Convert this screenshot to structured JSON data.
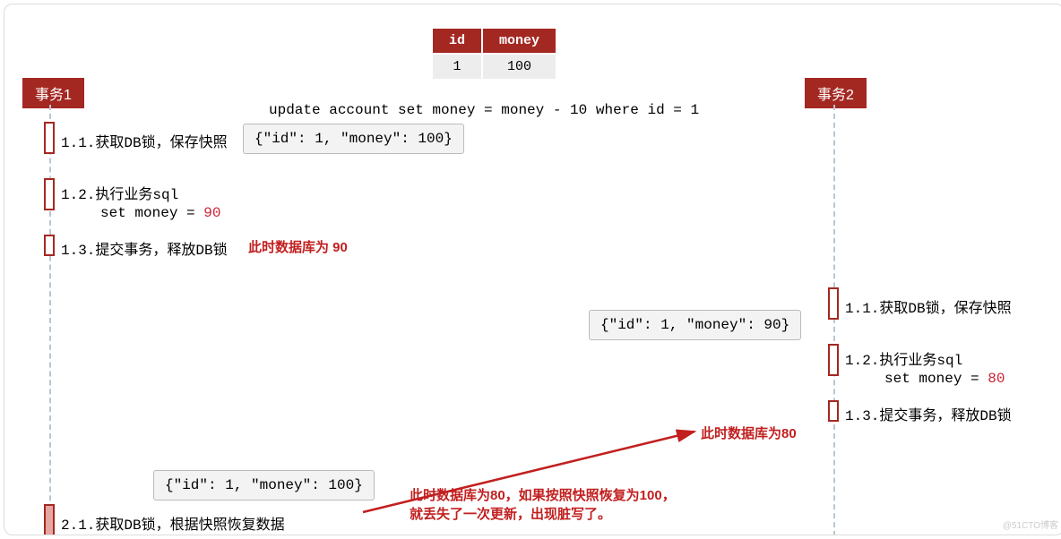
{
  "table": {
    "headers": [
      "id",
      "money"
    ],
    "row": [
      "1",
      "100"
    ]
  },
  "sql_line": "update account set money = money - 10 where id = 1",
  "tx1": {
    "title": "事务1",
    "steps": {
      "s11": "1.1.获取DB锁，保存快照",
      "s12": "1.2.执行业务sql",
      "s12_sub_prefix": "set money = ",
      "s12_sub_val": "90",
      "s13": "1.3.提交事务，释放DB锁",
      "s21": "2.1.获取DB锁，根据快照恢复数据"
    }
  },
  "tx2": {
    "title": "事务2",
    "steps": {
      "s11": "1.1.获取DB锁，保存快照",
      "s12": "1.2.执行业务sql",
      "s12_sub_prefix": "set money = ",
      "s12_sub_val": "80",
      "s13": "1.3.提交事务，释放DB锁"
    }
  },
  "snapshots": {
    "a": "{\"id\": 1, \"money\": 100}",
    "b": "{\"id\": 1, \"money\": 90}",
    "c": "{\"id\": 1, \"money\": 100}"
  },
  "notes": {
    "after_tx1": "此时数据库为 90",
    "after_tx2": "此时数据库为80",
    "conflict_line1": "此时数据库为80，如果按照快照恢复为100，",
    "conflict_line2": "就丢失了一次更新，出现脏写了。"
  },
  "watermark": "@51CTO博客",
  "colors": {
    "brand": "#a42822",
    "red_text": "#c21f1f"
  }
}
